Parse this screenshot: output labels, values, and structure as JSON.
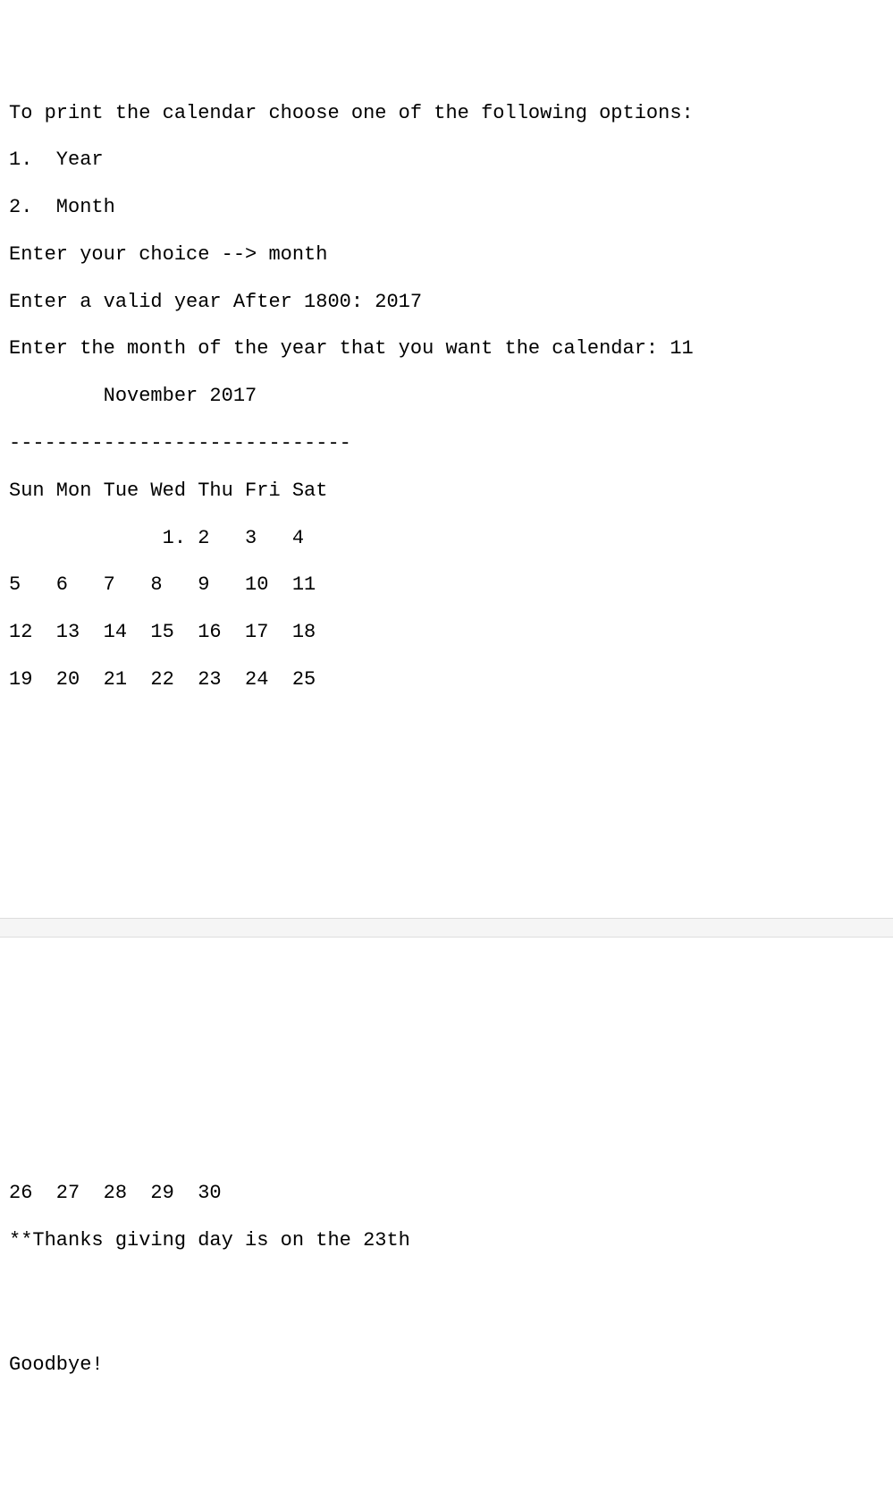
{
  "output": {
    "header": "To print the calendar choose one of the following options:",
    "opt1": "1.  Year",
    "opt2": "2.  Month",
    "choice_line": "Enter your choice --> month",
    "year_line": "Enter a valid year After 1800: 2017",
    "month_line": "Enter the month of the year that you want the calendar: 11",
    "title": "        November 2017",
    "sep": "-----------------------------",
    "days": "Sun Mon Tue Wed Thu Fri Sat",
    "row1": "             1. 2   3   4",
    "row2": "5   6   7   8   9   10  11",
    "row3": "12  13  14  15  16  17  18",
    "row4": "19  20  21  22  23  24  25",
    "row5": "26  27  28  29  30",
    "holiday": "**Thanks giving day is on the 23th",
    "bye": "Goodbye!"
  }
}
